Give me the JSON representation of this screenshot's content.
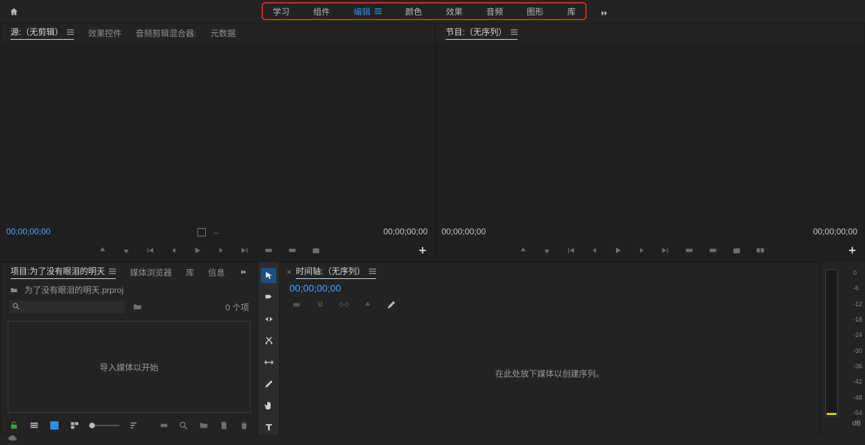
{
  "workspaces": {
    "items": [
      {
        "label": "学习",
        "active": false
      },
      {
        "label": "组件",
        "active": false
      },
      {
        "label": "编辑",
        "active": true
      },
      {
        "label": "颜色",
        "active": false
      },
      {
        "label": "效果",
        "active": false
      },
      {
        "label": "音频",
        "active": false
      },
      {
        "label": "图形",
        "active": false
      },
      {
        "label": "库",
        "active": false
      }
    ]
  },
  "source_panel": {
    "tabs": [
      {
        "label": "源:（无剪辑）",
        "active": true
      },
      {
        "label": "效果控件",
        "active": false
      },
      {
        "label": "音频剪辑混合器:",
        "active": false
      },
      {
        "label": "元数据",
        "active": false
      }
    ],
    "tc_in": "00;00;00;00",
    "tc_out": "00;00;00;00"
  },
  "program_panel": {
    "tab": "节目:（无序列）",
    "tc_in": "00;00;00;00",
    "tc_out": "00;00;00;00"
  },
  "project_panel": {
    "tabs": [
      {
        "label": "项目:为了没有眼泪的明天"
      },
      {
        "label": "媒体浏览器"
      },
      {
        "label": "库"
      },
      {
        "label": "信息"
      }
    ],
    "file": "为了没有眼泪的明天.prproj",
    "search_placeholder": "",
    "count": "0 个项",
    "drop_label": "导入媒体以开始"
  },
  "timeline_panel": {
    "tab": "时间轴:（无序列）",
    "tc": "00;00;00;00",
    "drop_label": "在此处放下媒体以创建序列。"
  },
  "meter": {
    "ticks": [
      "0",
      "-6",
      "-12",
      "-18",
      "-24",
      "-30",
      "-36",
      "-42",
      "-48",
      "-54"
    ],
    "unit": "dB"
  },
  "colors": {
    "accent": "#2d8ceb",
    "highlight_box": "#d62a1e"
  }
}
